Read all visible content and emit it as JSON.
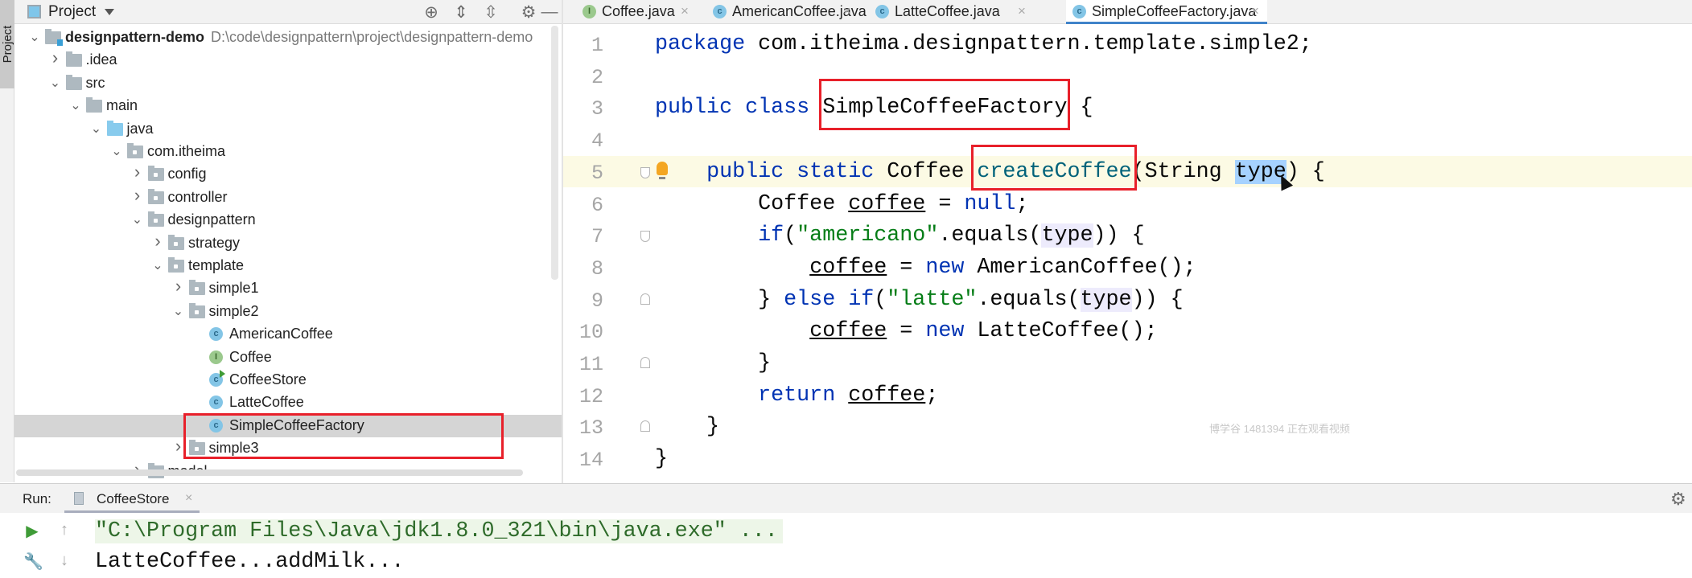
{
  "left_strip": {
    "project_tab": "Project"
  },
  "project_panel": {
    "title": "Project",
    "icons": [
      "locate-icon",
      "expand-all-icon",
      "collapse-all-icon",
      "gear-icon",
      "minimize-icon"
    ]
  },
  "tree": [
    {
      "depth": 0,
      "label": "designpattern-demo",
      "path": "D:\\code\\designpattern\\project\\designpattern-demo",
      "kind": "module",
      "expanded": true,
      "bold": true
    },
    {
      "depth": 1,
      "label": ".idea",
      "kind": "folder",
      "expanded": false
    },
    {
      "depth": 1,
      "label": "src",
      "kind": "folder",
      "expanded": true
    },
    {
      "depth": 2,
      "label": "main",
      "kind": "folder",
      "expanded": true
    },
    {
      "depth": 3,
      "label": "java",
      "kind": "source",
      "expanded": true
    },
    {
      "depth": 4,
      "label": "com.itheima",
      "kind": "package",
      "expanded": true
    },
    {
      "depth": 5,
      "label": "config",
      "kind": "package",
      "expanded": false
    },
    {
      "depth": 5,
      "label": "controller",
      "kind": "package",
      "expanded": false
    },
    {
      "depth": 5,
      "label": "designpattern",
      "kind": "package",
      "expanded": true
    },
    {
      "depth": 6,
      "label": "strategy",
      "kind": "package",
      "expanded": false
    },
    {
      "depth": 6,
      "label": "template",
      "kind": "package",
      "expanded": true
    },
    {
      "depth": 7,
      "label": "simple1",
      "kind": "package",
      "expanded": false
    },
    {
      "depth": 7,
      "label": "simple2",
      "kind": "package",
      "expanded": true
    },
    {
      "depth": 8,
      "label": "AmericanCoffee",
      "kind": "class"
    },
    {
      "depth": 8,
      "label": "Coffee",
      "kind": "interface"
    },
    {
      "depth": 8,
      "label": "CoffeeStore",
      "kind": "runnable-class"
    },
    {
      "depth": 8,
      "label": "LatteCoffee",
      "kind": "class"
    },
    {
      "depth": 8,
      "label": "SimpleCoffeeFactory",
      "kind": "class",
      "selected": true
    },
    {
      "depth": 7,
      "label": "simple3",
      "kind": "package",
      "expanded": false
    },
    {
      "depth": 5,
      "label": "model",
      "kind": "package",
      "expanded": false
    }
  ],
  "editor_tabs": [
    {
      "label": "Coffee.java",
      "kind": "interface",
      "active": false
    },
    {
      "label": "AmericanCoffee.java",
      "kind": "class",
      "active": false
    },
    {
      "label": "LatteCoffee.java",
      "kind": "class",
      "active": false
    },
    {
      "label": "SimpleCoffeeFactory.java",
      "kind": "class",
      "active": true
    }
  ],
  "editor": {
    "current_line": 5,
    "lines": [
      {
        "n": "1",
        "tokens": [
          [
            "kw",
            "package"
          ],
          [
            "",
            " com.itheima.designpattern.template.simple2;"
          ]
        ]
      },
      {
        "n": "2",
        "tokens": []
      },
      {
        "n": "3",
        "tokens": [
          [
            "kw",
            "public class"
          ],
          [
            "",
            " "
          ],
          [
            "",
            "SimpleCoffeeFactory"
          ],
          [
            "",
            " {"
          ]
        ]
      },
      {
        "n": "4",
        "tokens": []
      },
      {
        "n": "5",
        "tokens": [
          [
            "",
            "    "
          ],
          [
            "kw",
            "public static"
          ],
          [
            "",
            " Coffee "
          ],
          [
            "fn",
            "createCoffee"
          ],
          [
            "",
            "(String "
          ],
          [
            "sel",
            "type"
          ],
          [
            "",
            ") {"
          ]
        ]
      },
      {
        "n": "6",
        "tokens": [
          [
            "",
            "        Coffee "
          ],
          [
            "var",
            "coffee"
          ],
          [
            "",
            " = "
          ],
          [
            "kw",
            "null"
          ],
          [
            "",
            ";"
          ]
        ]
      },
      {
        "n": "7",
        "tokens": [
          [
            "",
            "        "
          ],
          [
            "kw",
            "if"
          ],
          [
            "",
            "("
          ],
          [
            "str",
            "\"americano\""
          ],
          [
            "",
            ".equals("
          ],
          [
            "usage",
            "type"
          ],
          [
            "",
            ")) {"
          ]
        ]
      },
      {
        "n": "8",
        "tokens": [
          [
            "",
            "            "
          ],
          [
            "var",
            "coffee"
          ],
          [
            "",
            " = "
          ],
          [
            "kw",
            "new"
          ],
          [
            "",
            " AmericanCoffee();"
          ]
        ]
      },
      {
        "n": "9",
        "tokens": [
          [
            "",
            "        } "
          ],
          [
            "kw",
            "else if"
          ],
          [
            "",
            "("
          ],
          [
            "str",
            "\"latte\""
          ],
          [
            "",
            ".equals("
          ],
          [
            "usage",
            "type"
          ],
          [
            "",
            ")) {"
          ]
        ]
      },
      {
        "n": "10",
        "tokens": [
          [
            "",
            "            "
          ],
          [
            "var",
            "coffee"
          ],
          [
            "",
            " = "
          ],
          [
            "kw",
            "new"
          ],
          [
            "",
            " LatteCoffee();"
          ]
        ]
      },
      {
        "n": "11",
        "tokens": [
          [
            "",
            "        }"
          ]
        ]
      },
      {
        "n": "12",
        "tokens": [
          [
            "",
            "        "
          ],
          [
            "kw",
            "return"
          ],
          [
            "",
            " "
          ],
          [
            "var",
            "coffee"
          ],
          [
            "",
            ";"
          ]
        ]
      },
      {
        "n": "13",
        "tokens": [
          [
            "",
            "    }"
          ]
        ]
      },
      {
        "n": "14",
        "tokens": [
          [
            "",
            "}"
          ]
        ]
      }
    ]
  },
  "watermark": "博学谷 1481394 正在观看视频",
  "run_panel": {
    "label": "Run:",
    "tab": "CoffeeStore",
    "output": [
      "\"C:\\Program Files\\Java\\jdk1.8.0_321\\bin\\java.exe\" ...",
      "LatteCoffee...addMilk..."
    ]
  },
  "colors": {
    "keyword": "#0033b3",
    "method": "#00627a",
    "string": "#067d17",
    "annotation_box": "#e8202a",
    "selection": "#a6d2ff",
    "active_tab_underline": "#4083c9"
  }
}
